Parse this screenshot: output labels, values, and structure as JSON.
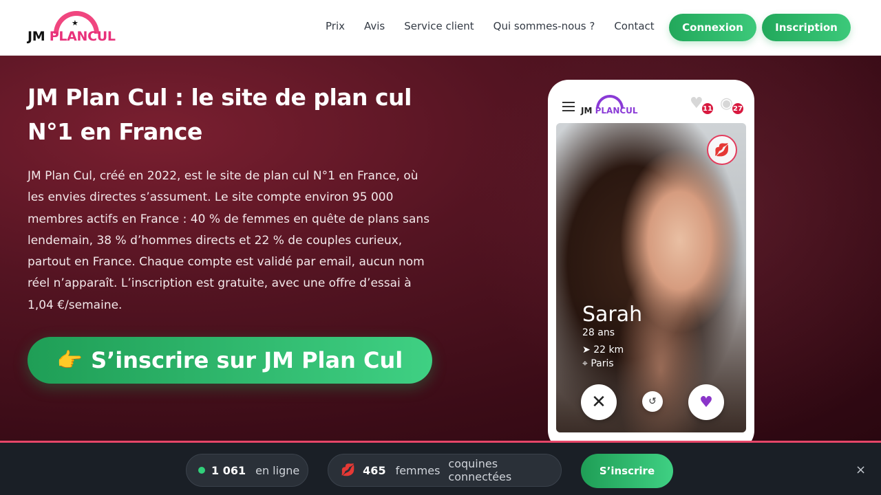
{
  "header": {
    "logo": {
      "part1": "JM",
      "part2": "PLANCUL"
    },
    "nav": [
      "Prix",
      "Avis",
      "Service client",
      "Qui sommes-nous ?",
      "Contact"
    ],
    "login_label": "Connexion",
    "signup_label": "Inscription"
  },
  "hero": {
    "title": "JM Plan Cul : le site de plan cul N°1 en France",
    "text": "JM Plan Cul, créé en 2022, est le site de plan cul N°1 en France, où les envies directes s’assument. Le site compte environ 95 000 membres actifs en France : 40 % de femmes en quête de plans sans lendemain, 38 % d’hommes directs et 22 % de couples curieux, partout en France. Chaque compte est validé par email, aucun nom réel n’apparaît. L’inscription est gratuite, avec une offre d’essai à 1,04 €/semaine.",
    "cta_icon": "👉",
    "cta_label": "S’inscrire sur JM Plan Cul"
  },
  "phone": {
    "logo": {
      "part1": "JM",
      "part2": "PLANCUL"
    },
    "likes_count": "11",
    "views_count": "27",
    "profile": {
      "name": "Sarah",
      "age": "28 ans",
      "distance": "22 km",
      "city": "Paris"
    }
  },
  "bottom_bar": {
    "online_count": "1 061",
    "online_label": "en ligne",
    "women_count": "465",
    "women_label": "femmes",
    "women_suffix": "coquines connectées",
    "cta_label": "S’inscrire",
    "close_glyph": "×"
  },
  "colors": {
    "brand_pink": "#e8317a",
    "brand_green": "#2bb566",
    "hero_bg": "#541422",
    "bottom_bg": "#1a1f26",
    "accent_red": "#e64668"
  }
}
